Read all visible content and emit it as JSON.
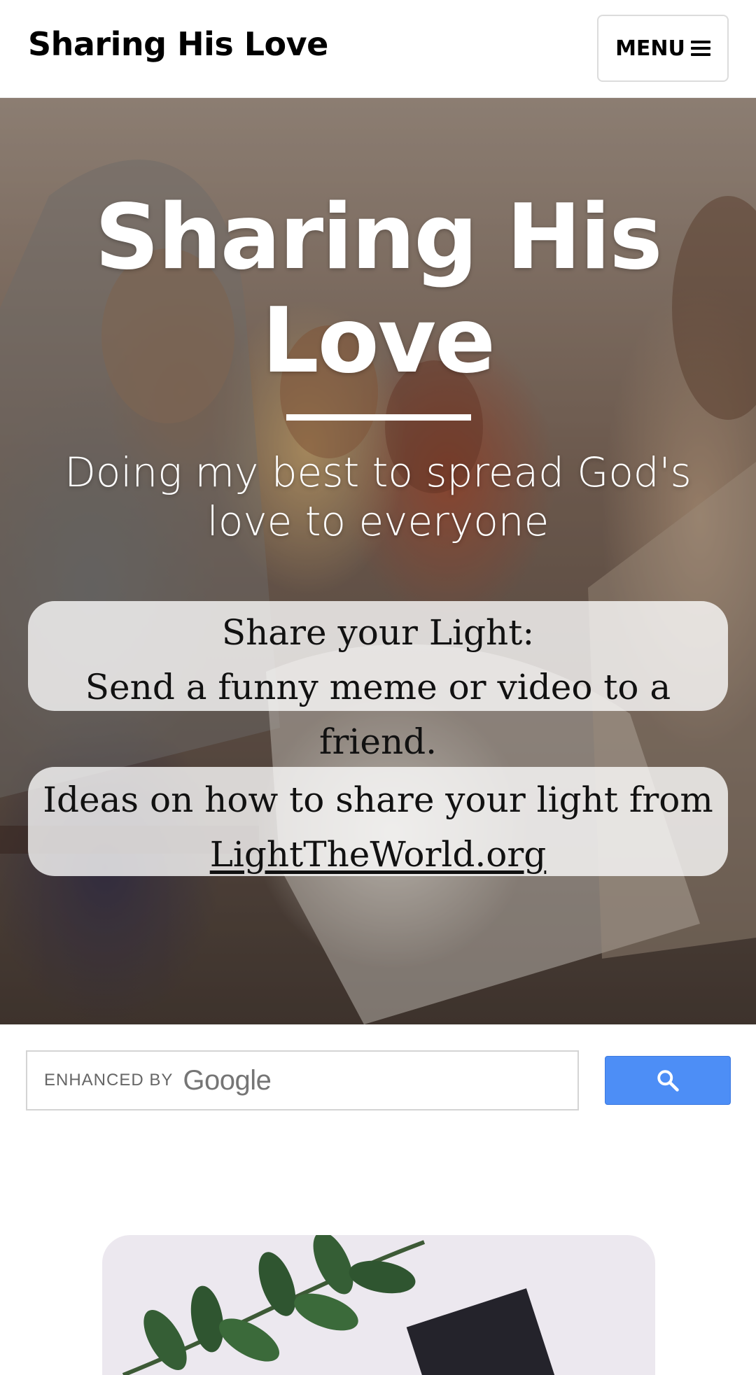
{
  "header": {
    "site_title": "Sharing His Love",
    "menu_label": "MENU",
    "menu_icon": "hamburger-icon"
  },
  "hero": {
    "title": "Sharing His Love",
    "subtitle": "Doing my best to spread God's love to everyone",
    "callout_1": {
      "line_1": "Share your Light:",
      "line_2": "Send a funny meme or video to a friend."
    },
    "callout_2": {
      "line_1": "Ideas on how to share your light from",
      "link_text": "LightTheWorld.org"
    }
  },
  "search": {
    "branding_prefix": "ENHANCED BY",
    "branding_name": "Google",
    "button_icon": "search-icon",
    "button_color": "#4d8ef6"
  },
  "featured": {
    "image_icon": "leaf-branch-icon"
  }
}
